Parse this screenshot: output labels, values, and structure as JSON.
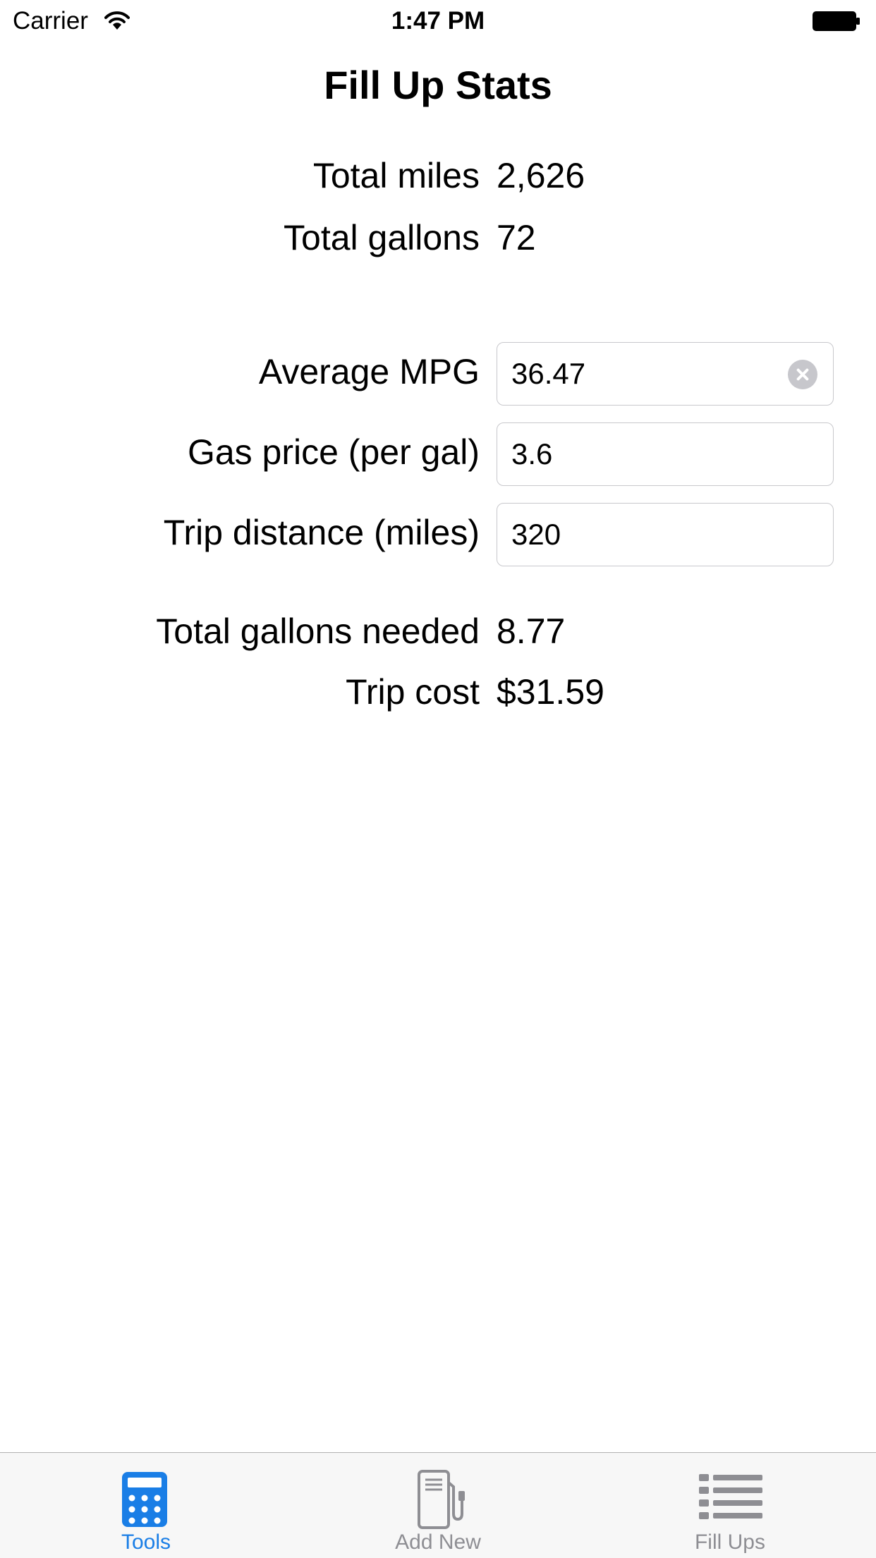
{
  "status_bar": {
    "carrier": "Carrier",
    "time": "1:47 PM"
  },
  "title": "Fill Up Stats",
  "totals": [
    {
      "label": "Total miles",
      "value": "2,626"
    },
    {
      "label": "Total gallons",
      "value": "72"
    }
  ],
  "inputs": {
    "average_mpg": {
      "label": "Average MPG",
      "value": "36.47"
    },
    "gas_price": {
      "label": "Gas price (per gal)",
      "value": "3.6"
    },
    "trip_distance": {
      "label": "Trip distance (miles)",
      "value": "320"
    }
  },
  "results": [
    {
      "label": "Total gallons needed",
      "value": "8.77"
    },
    {
      "label": "Trip cost",
      "value": "$31.59"
    }
  ],
  "tab_bar": {
    "tabs": [
      {
        "label": "Tools",
        "icon": "calculator-icon",
        "active": true
      },
      {
        "label": "Add New",
        "icon": "gas-pump-icon",
        "active": false
      },
      {
        "label": "Fill Ups",
        "icon": "list-icon",
        "active": false
      }
    ]
  },
  "colors": {
    "accent": "#1a7ee6",
    "inactive": "#8e8e93",
    "clear_button": "#c7c7cc"
  }
}
